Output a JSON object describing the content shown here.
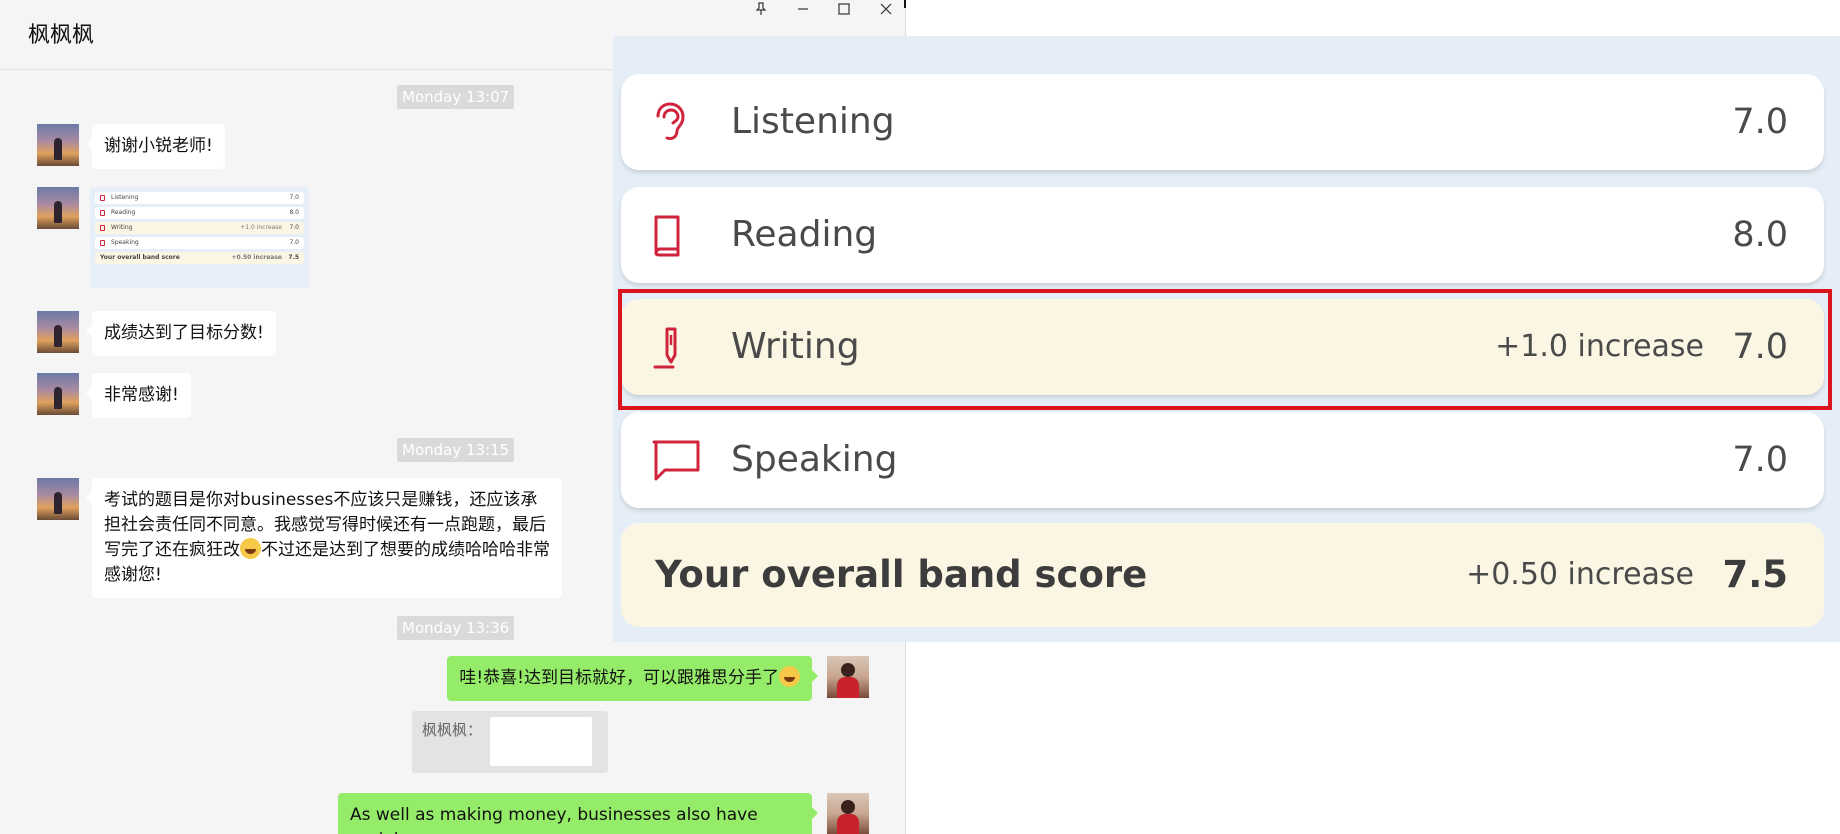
{
  "window": {
    "title": "枫枫枫",
    "controls": {
      "pin": "pin-icon",
      "minimize": "minimize-icon",
      "maximize": "maximize-icon",
      "close": "close-icon"
    }
  },
  "chat": {
    "timestamps": [
      "Monday 13:07",
      "Monday 13:15",
      "Monday 13:36"
    ],
    "msg_thanks": "谢谢小锐老师!",
    "msg_reached": "成绩达到了目标分数!",
    "msg_very_thanks": "非常感谢!",
    "msg_long_1": "考试的题目是你对businesses不应该只是赚钱，还应该承担社会责任同不同意。我感觉写得时候还有一点跑题，最后写完了还在疯狂改",
    "msg_long_2": "不过还是达到了想要的成绩哈哈哈非常感谢您!",
    "reply_congrats": "哇!恭喜!达到目标就好，可以跟雅思分手了",
    "quote_sender": "枫枫枫：",
    "reply_english": "As well as making money, businesses also have social"
  },
  "thumbnail": {
    "rows": [
      {
        "label": "Listening",
        "inc": "",
        "value": "7.0"
      },
      {
        "label": "Reading",
        "inc": "",
        "value": "8.0"
      },
      {
        "label": "Writing",
        "inc": "+1.0 increase",
        "value": "7.0"
      },
      {
        "label": "Speaking",
        "inc": "",
        "value": "7.0"
      }
    ],
    "total": {
      "label": "Your overall band score",
      "inc": "+0.50 increase",
      "value": "7.5"
    }
  },
  "scores": {
    "listening": {
      "label": "Listening",
      "value": "7.0",
      "icon": "ear-icon"
    },
    "reading": {
      "label": "Reading",
      "value": "8.0",
      "icon": "book-icon"
    },
    "writing": {
      "label": "Writing",
      "increase": "+1.0 increase",
      "value": "7.0",
      "icon": "pen-icon"
    },
    "speaking": {
      "label": "Speaking",
      "value": "7.0",
      "icon": "speech-bubble-icon"
    },
    "overall": {
      "label": "Your overall band score",
      "increase": "+0.50 increase",
      "value": "7.5"
    }
  },
  "colors": {
    "accent_red": "#d0243c",
    "highlight_border": "#d9151d",
    "cream": "#fbf6e3",
    "panel_bg": "#e5eef7",
    "bubble_green": "#95ec69"
  }
}
